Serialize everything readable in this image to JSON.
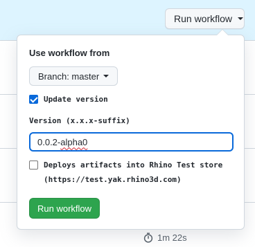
{
  "header": {
    "run_workflow_label": "Run workflow"
  },
  "popover": {
    "heading": "Use workflow from",
    "branch_label": "Branch: master",
    "update_version": {
      "label": "Update version",
      "checked": true
    },
    "version_field": {
      "label": "Version (x.x.x-suffix)",
      "value_plain": "0.0.2-",
      "value_flagged": "alpha0"
    },
    "deploy": {
      "line1": "Deploys artifacts into Rhino Test store",
      "line2": "(https://test.yak.rhino3d.com)",
      "checked": false
    },
    "submit_label": "Run workflow"
  },
  "run_meta": {
    "duration": "1m 22s"
  },
  "colors": {
    "accent": "#0969da",
    "success": "#2da44e",
    "header_bg": "#ddf4ff"
  }
}
